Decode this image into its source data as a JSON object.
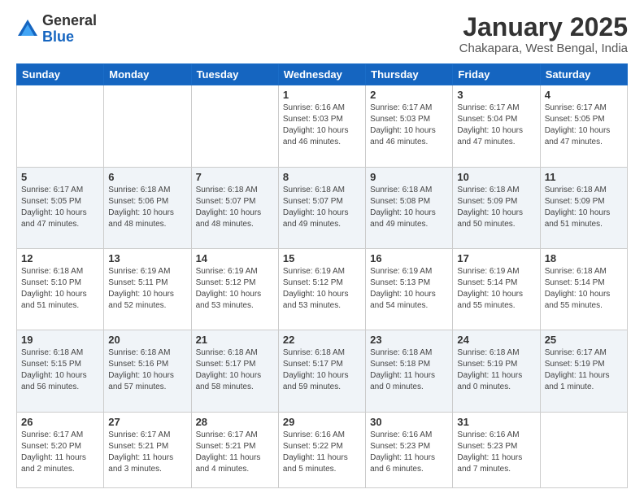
{
  "header": {
    "logo_general": "General",
    "logo_blue": "Blue",
    "month_title": "January 2025",
    "location": "Chakapara, West Bengal, India"
  },
  "weekdays": [
    "Sunday",
    "Monday",
    "Tuesday",
    "Wednesday",
    "Thursday",
    "Friday",
    "Saturday"
  ],
  "weeks": [
    [
      {
        "day": "",
        "info": ""
      },
      {
        "day": "",
        "info": ""
      },
      {
        "day": "",
        "info": ""
      },
      {
        "day": "1",
        "info": "Sunrise: 6:16 AM\nSunset: 5:03 PM\nDaylight: 10 hours\nand 46 minutes."
      },
      {
        "day": "2",
        "info": "Sunrise: 6:17 AM\nSunset: 5:03 PM\nDaylight: 10 hours\nand 46 minutes."
      },
      {
        "day": "3",
        "info": "Sunrise: 6:17 AM\nSunset: 5:04 PM\nDaylight: 10 hours\nand 47 minutes."
      },
      {
        "day": "4",
        "info": "Sunrise: 6:17 AM\nSunset: 5:05 PM\nDaylight: 10 hours\nand 47 minutes."
      }
    ],
    [
      {
        "day": "5",
        "info": "Sunrise: 6:17 AM\nSunset: 5:05 PM\nDaylight: 10 hours\nand 47 minutes."
      },
      {
        "day": "6",
        "info": "Sunrise: 6:18 AM\nSunset: 5:06 PM\nDaylight: 10 hours\nand 48 minutes."
      },
      {
        "day": "7",
        "info": "Sunrise: 6:18 AM\nSunset: 5:07 PM\nDaylight: 10 hours\nand 48 minutes."
      },
      {
        "day": "8",
        "info": "Sunrise: 6:18 AM\nSunset: 5:07 PM\nDaylight: 10 hours\nand 49 minutes."
      },
      {
        "day": "9",
        "info": "Sunrise: 6:18 AM\nSunset: 5:08 PM\nDaylight: 10 hours\nand 49 minutes."
      },
      {
        "day": "10",
        "info": "Sunrise: 6:18 AM\nSunset: 5:09 PM\nDaylight: 10 hours\nand 50 minutes."
      },
      {
        "day": "11",
        "info": "Sunrise: 6:18 AM\nSunset: 5:09 PM\nDaylight: 10 hours\nand 51 minutes."
      }
    ],
    [
      {
        "day": "12",
        "info": "Sunrise: 6:18 AM\nSunset: 5:10 PM\nDaylight: 10 hours\nand 51 minutes."
      },
      {
        "day": "13",
        "info": "Sunrise: 6:19 AM\nSunset: 5:11 PM\nDaylight: 10 hours\nand 52 minutes."
      },
      {
        "day": "14",
        "info": "Sunrise: 6:19 AM\nSunset: 5:12 PM\nDaylight: 10 hours\nand 53 minutes."
      },
      {
        "day": "15",
        "info": "Sunrise: 6:19 AM\nSunset: 5:12 PM\nDaylight: 10 hours\nand 53 minutes."
      },
      {
        "day": "16",
        "info": "Sunrise: 6:19 AM\nSunset: 5:13 PM\nDaylight: 10 hours\nand 54 minutes."
      },
      {
        "day": "17",
        "info": "Sunrise: 6:19 AM\nSunset: 5:14 PM\nDaylight: 10 hours\nand 55 minutes."
      },
      {
        "day": "18",
        "info": "Sunrise: 6:18 AM\nSunset: 5:14 PM\nDaylight: 10 hours\nand 55 minutes."
      }
    ],
    [
      {
        "day": "19",
        "info": "Sunrise: 6:18 AM\nSunset: 5:15 PM\nDaylight: 10 hours\nand 56 minutes."
      },
      {
        "day": "20",
        "info": "Sunrise: 6:18 AM\nSunset: 5:16 PM\nDaylight: 10 hours\nand 57 minutes."
      },
      {
        "day": "21",
        "info": "Sunrise: 6:18 AM\nSunset: 5:17 PM\nDaylight: 10 hours\nand 58 minutes."
      },
      {
        "day": "22",
        "info": "Sunrise: 6:18 AM\nSunset: 5:17 PM\nDaylight: 10 hours\nand 59 minutes."
      },
      {
        "day": "23",
        "info": "Sunrise: 6:18 AM\nSunset: 5:18 PM\nDaylight: 11 hours\nand 0 minutes."
      },
      {
        "day": "24",
        "info": "Sunrise: 6:18 AM\nSunset: 5:19 PM\nDaylight: 11 hours\nand 0 minutes."
      },
      {
        "day": "25",
        "info": "Sunrise: 6:17 AM\nSunset: 5:19 PM\nDaylight: 11 hours\nand 1 minute."
      }
    ],
    [
      {
        "day": "26",
        "info": "Sunrise: 6:17 AM\nSunset: 5:20 PM\nDaylight: 11 hours\nand 2 minutes."
      },
      {
        "day": "27",
        "info": "Sunrise: 6:17 AM\nSunset: 5:21 PM\nDaylight: 11 hours\nand 3 minutes."
      },
      {
        "day": "28",
        "info": "Sunrise: 6:17 AM\nSunset: 5:21 PM\nDaylight: 11 hours\nand 4 minutes."
      },
      {
        "day": "29",
        "info": "Sunrise: 6:16 AM\nSunset: 5:22 PM\nDaylight: 11 hours\nand 5 minutes."
      },
      {
        "day": "30",
        "info": "Sunrise: 6:16 AM\nSunset: 5:23 PM\nDaylight: 11 hours\nand 6 minutes."
      },
      {
        "day": "31",
        "info": "Sunrise: 6:16 AM\nSunset: 5:23 PM\nDaylight: 11 hours\nand 7 minutes."
      },
      {
        "day": "",
        "info": ""
      }
    ]
  ]
}
